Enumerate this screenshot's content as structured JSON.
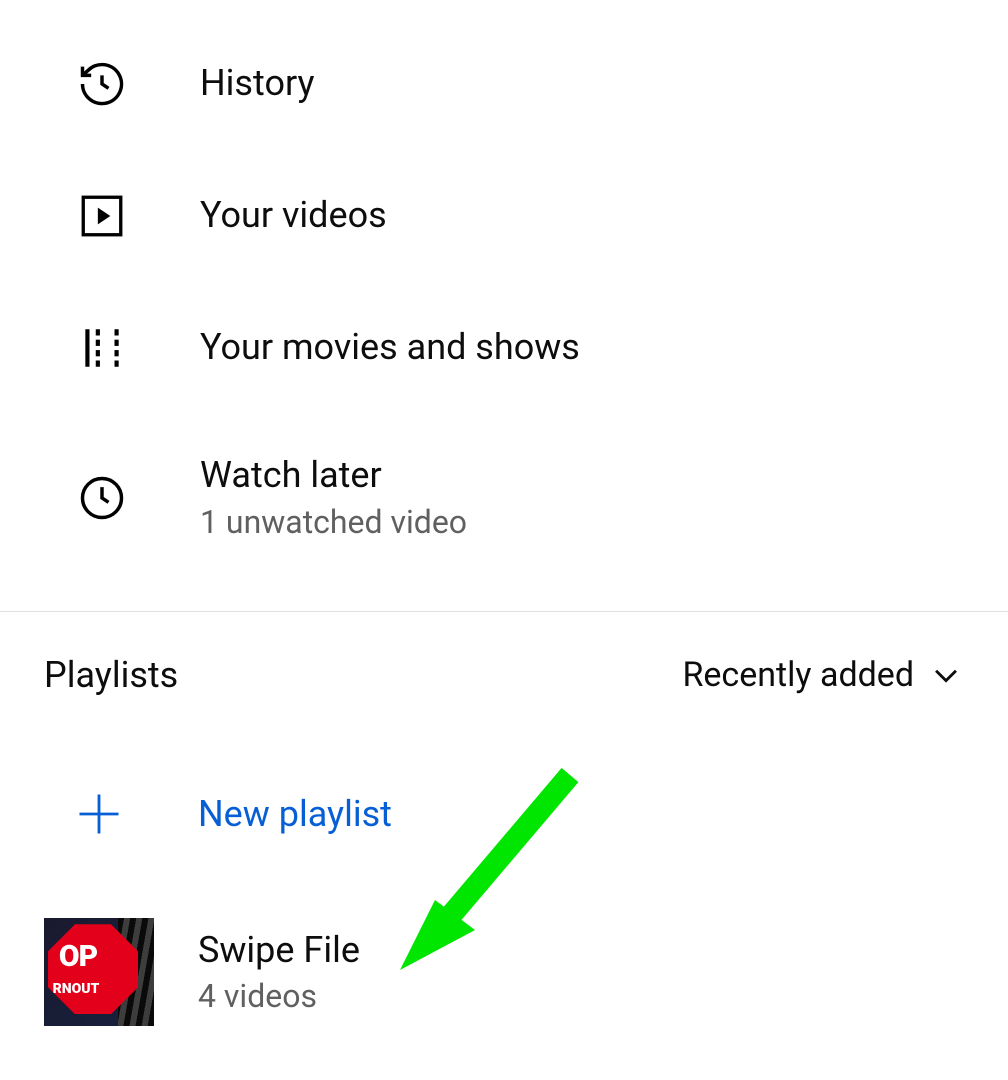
{
  "library": {
    "items": [
      {
        "label": "History",
        "sublabel": ""
      },
      {
        "label": "Your videos",
        "sublabel": ""
      },
      {
        "label": "Your movies and shows",
        "sublabel": ""
      },
      {
        "label": "Watch later",
        "sublabel": "1 unwatched video"
      }
    ]
  },
  "playlists": {
    "title": "Playlists",
    "sort_label": "Recently added",
    "new_label": "New playlist",
    "items": [
      {
        "name": "Swipe File",
        "count": "4 videos",
        "thumb_text1": "OP",
        "thumb_text2": "RNOUT"
      }
    ]
  },
  "colors": {
    "link_blue": "#065fd4",
    "annotation_green": "#00e600"
  }
}
